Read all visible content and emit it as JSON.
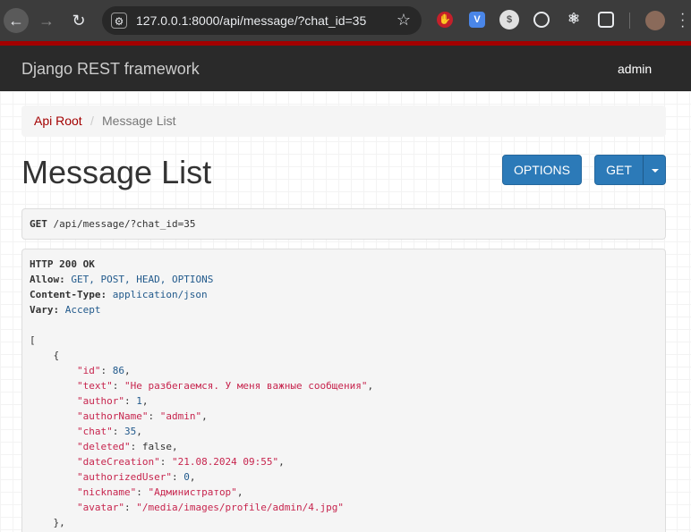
{
  "browser": {
    "url": "127.0.0.1:8000/api/message/?chat_id=35",
    "back_icon": "arrow-left-icon",
    "forward_icon": "arrow-right-icon",
    "reload_icon": "reload-icon",
    "star_icon": "star-icon"
  },
  "navbar": {
    "brand": "Django REST framework",
    "user": "admin"
  },
  "breadcrumb": {
    "root": "Api Root",
    "separator": "/",
    "current": "Message List"
  },
  "page": {
    "title": "Message List",
    "options_label": "OPTIONS",
    "get_label": "GET"
  },
  "request": {
    "method": "GET",
    "path": " /api/message/?chat_id=35"
  },
  "response": {
    "status": "HTTP 200 OK",
    "headers": [
      {
        "name": "Allow:",
        "value": " GET, POST, HEAD, OPTIONS"
      },
      {
        "name": "Content-Type:",
        "value": " application/json"
      },
      {
        "name": "Vary:",
        "value": " Accept"
      }
    ],
    "open_bracket": "[",
    "open_brace": "    {",
    "fields": [
      {
        "key": "\"id\"",
        "sep": ": ",
        "value": "86",
        "type": "num",
        "trail": ","
      },
      {
        "key": "\"text\"",
        "sep": ": ",
        "value": "\"Не разбегаемся. У меня важные сообщения\"",
        "type": "str",
        "trail": ","
      },
      {
        "key": "\"author\"",
        "sep": ": ",
        "value": "1",
        "type": "num",
        "trail": ","
      },
      {
        "key": "\"authorName\"",
        "sep": ": ",
        "value": "\"admin\"",
        "type": "str",
        "trail": ","
      },
      {
        "key": "\"chat\"",
        "sep": ": ",
        "value": "35",
        "type": "num",
        "trail": ","
      },
      {
        "key": "\"deleted\"",
        "sep": ": ",
        "value": "false",
        "type": "bool",
        "trail": ","
      },
      {
        "key": "\"dateCreation\"",
        "sep": ": ",
        "value": "\"21.08.2024 09:55\"",
        "type": "str",
        "trail": ","
      },
      {
        "key": "\"authorizedUser\"",
        "sep": ": ",
        "value": "0",
        "type": "num",
        "trail": ","
      },
      {
        "key": "\"nickname\"",
        "sep": ": ",
        "value": "\"Администратор\"",
        "type": "str",
        "trail": ","
      },
      {
        "key": "\"avatar\"",
        "sep": ": ",
        "value": "\"/media/images/profile/admin/4.jpg\"",
        "type": "str",
        "trail": ""
      }
    ],
    "close_brace": "    },"
  }
}
